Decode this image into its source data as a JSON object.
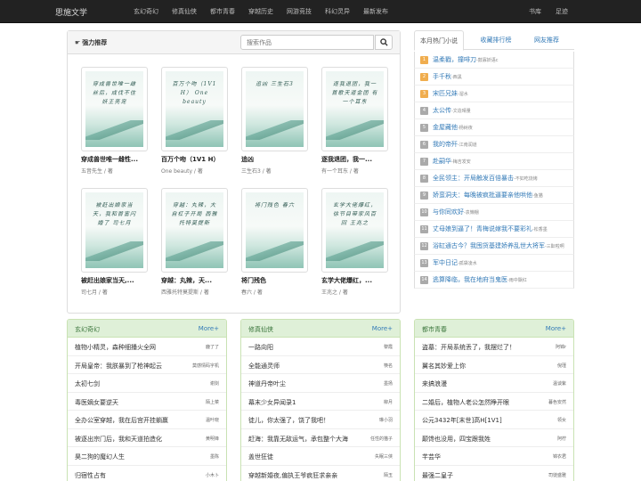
{
  "nav": {
    "brand": "思施文学",
    "links": [
      "玄幻奇幻",
      "修真仙侠",
      "都市青春",
      "穿越历史",
      "网游竞技",
      "科幻灵异",
      "最新发布"
    ],
    "right": [
      "书库",
      "足迹"
    ]
  },
  "recommend": {
    "title": "强力推荐",
    "search_placeholder": "搜索作品",
    "books": [
      {
        "cover": "穿成兽世唯一雌丝后，成伐不住妖王亮宠",
        "title": "穿成兽世唯一雌性...",
        "author": "五音先生 / 著"
      },
      {
        "cover": "百万个吻（1V1 H） One beauty",
        "title": "百万个吻（1V1 H）",
        "author": "One beauty / 著"
      },
      {
        "cover": "追凶 三生石3",
        "title": "追凶",
        "author": "三生石3 / 著"
      },
      {
        "cover": "逐我退团，我一首歌天道金团 有一个耳东",
        "title": "逐我退团，我一...",
        "author": "有一个耳东 / 著"
      },
      {
        "cover": "被赶出娘家当天，我和首富闪婚了 司七月",
        "title": "被赶出娘家当天,...",
        "author": "司七月 / 著"
      },
      {
        "cover": "穿越：丸辣，大自杠子开局 西雅托特莫提斯",
        "title": "穿越：丸辣，天...",
        "author": "西雅托特莫提斯 / 著"
      },
      {
        "cover": "将门残色 春六",
        "title": "将门残色",
        "author": "春六 / 著"
      },
      {
        "cover": "玄学大佬爆红，徐节目带家风百回 王兆之",
        "title": "玄学大佬爆红，...",
        "author": "王兆之 / 著"
      }
    ]
  },
  "tabs": {
    "labels": [
      "本月热门小说",
      "收藏排行榜",
      "网友推荐"
    ],
    "items": [
      {
        "rank": "1",
        "title": "温柔戳，撞啡刀",
        "author": "-鼓寡妖语c"
      },
      {
        "rank": "2",
        "title": "手千秋",
        "author": "-西黑"
      },
      {
        "rank": "3",
        "title": "宋匹兄妹",
        "author": "-溜水"
      },
      {
        "rank": "4",
        "title": "太公传",
        "author": "-文造晴量"
      },
      {
        "rank": "5",
        "title": "金屋藏他",
        "author": "-杨树夜"
      },
      {
        "rank": "6",
        "title": "我的帝歼",
        "author": "-江南润道"
      },
      {
        "rank": "7",
        "title": "赴嗣华",
        "author": "-梅吉发安"
      },
      {
        "rank": "8",
        "title": "全民领主：开局触发百倍暴击",
        "author": "-不如吃烧烤"
      },
      {
        "rank": "9",
        "title": "娇蛮洞夫：每晚被疯批逼要亲他哄他",
        "author": "-鱼猫"
      },
      {
        "rank": "10",
        "title": "与你同欢好",
        "author": "-袁懒棚"
      },
      {
        "rank": "11",
        "title": "丈母娘到逼了！青梅说嫁我不要彩礼",
        "author": "-松香墨"
      },
      {
        "rank": "12",
        "title": "浴缸通古今？我囤货基建娇养乱世大将军",
        "author": "-三酝啦啊"
      },
      {
        "rank": "13",
        "title": "军中日记",
        "author": "-孤袋凌水"
      },
      {
        "rank": "14",
        "title": "逃算降临，我在地府当鬼医",
        "author": "-雨中飘红"
      }
    ]
  },
  "categories": [
    {
      "name": "玄幻奇幻",
      "more": "More+",
      "rows": [
        {
          "t": "植物小精灵，森种细播火全网",
          "a": "鹿了了"
        },
        {
          "t": "开局皇帝：我朕暴到了枪神起云",
          "a": "莫感情码字机"
        },
        {
          "t": "太初七剑",
          "a": "谢剑"
        },
        {
          "t": "毒医嫡女要逆天",
          "a": "陌上菜"
        },
        {
          "t": "全办公室穿越，我在后宫开挂躺赢",
          "a": "温叶晓"
        },
        {
          "t": "被逐出宗门后，我和天道拍造化",
          "a": "黄明锋"
        },
        {
          "t": "昊二狗的魔幻人生",
          "a": "墨陈"
        },
        {
          "t": "归宿性占有",
          "a": "小木卜"
        }
      ]
    },
    {
      "name": "修真仙侠",
      "more": "More+",
      "rows": [
        {
          "t": "一路向阳",
          "a": "黎霞"
        },
        {
          "t": "全能通灵师",
          "a": "筷名"
        },
        {
          "t": "神道丹帝叶尘",
          "a": "墨扬"
        },
        {
          "t": "幕末少女异闻录1",
          "a": "柳月"
        },
        {
          "t": "徒儿，你太强了，饶了我吧！",
          "a": "琳小羽"
        },
        {
          "t": "赶海：我靠无敌运气，承包整个大海",
          "a": "任性的猫子"
        },
        {
          "t": "盖世狂徒",
          "a": "失眠三侠"
        },
        {
          "t": "穿越新婚夜,偏执王爷疯狂求亲亲",
          "a": "陌玉"
        }
      ]
    },
    {
      "name": "都市青春",
      "more": "More+",
      "rows": [
        {
          "t": "盗墓：开局系统丢了，我摆烂了！",
          "a": "阿锦r"
        },
        {
          "t": "翼名其妙爱上你",
          "a": "倪瑾"
        },
        {
          "t": "来搞浪漫",
          "a": "温谈紫"
        },
        {
          "t": "二婚后，植物人老公怎然睁开眼",
          "a": "暮色安然"
        },
        {
          "t": "公元3432年[末世]高H[1V1]",
          "a": "领女"
        },
        {
          "t": "颠馋也没用，四宝跟我姓",
          "a": "阿柠"
        },
        {
          "t": "芊芸华",
          "a": "锦衣君"
        },
        {
          "t": "最强二皇子",
          "a": "司徒盛雅"
        }
      ]
    }
  ]
}
